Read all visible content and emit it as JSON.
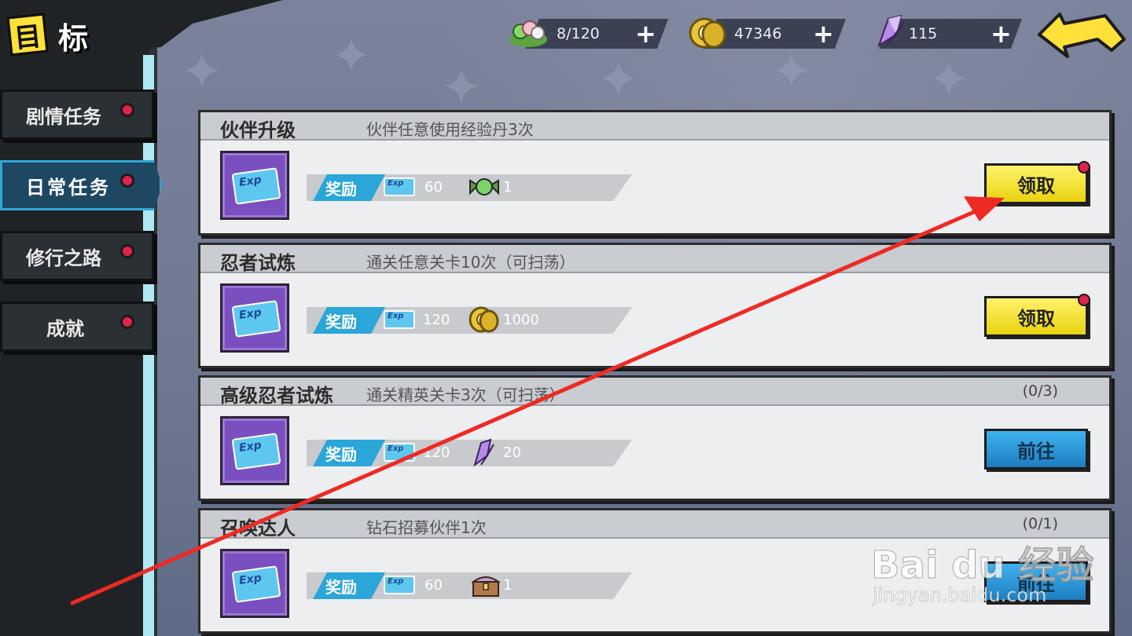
{
  "header": {
    "icon_char": "目",
    "title": "标"
  },
  "resources": [
    {
      "name": "stamina",
      "value": "8/120",
      "color": "#7bd86a"
    },
    {
      "name": "coins",
      "value": "47346",
      "color": "#e9c53a"
    },
    {
      "name": "diamonds",
      "value": "115",
      "color": "#a46be0"
    }
  ],
  "plus_symbol": "+",
  "tabs": [
    {
      "label": "剧情任务",
      "active": false
    },
    {
      "label": "日常任务",
      "active": true
    },
    {
      "label": "修行之路",
      "active": false
    },
    {
      "label": "成就",
      "active": false
    }
  ],
  "reward_label": "奖励",
  "exp_card_text": "Exp",
  "tasks": [
    {
      "title": "伙伴升级",
      "desc": "伙伴任意使用经验丹3次",
      "progress": "",
      "exp": "60",
      "item_value": "1",
      "item_icon": "green-candy-icon",
      "button": "领取",
      "button_type": "claim"
    },
    {
      "title": "忍者试炼",
      "desc": "通关任意关卡10次（可扫荡）",
      "progress": "",
      "exp": "120",
      "item_value": "1000",
      "item_icon": "coin-icon",
      "button": "领取",
      "button_type": "claim"
    },
    {
      "title": "高级忍者试炼",
      "desc": "通关精英关卡3次（可扫荡）",
      "progress": "(0/3)",
      "exp": "120",
      "item_value": "20",
      "item_icon": "diamond-icon",
      "button": "前往",
      "button_type": "go"
    },
    {
      "title": "召唤达人",
      "desc": "钻石招募伙伴1次",
      "progress": "(0/1)",
      "exp": "60",
      "item_value": "1",
      "item_icon": "treasure-chest-icon",
      "button": "前往",
      "button_type": "go"
    }
  ],
  "watermark": {
    "brand": "Bai  du 经验",
    "url": "jingyan.baidu.com"
  }
}
